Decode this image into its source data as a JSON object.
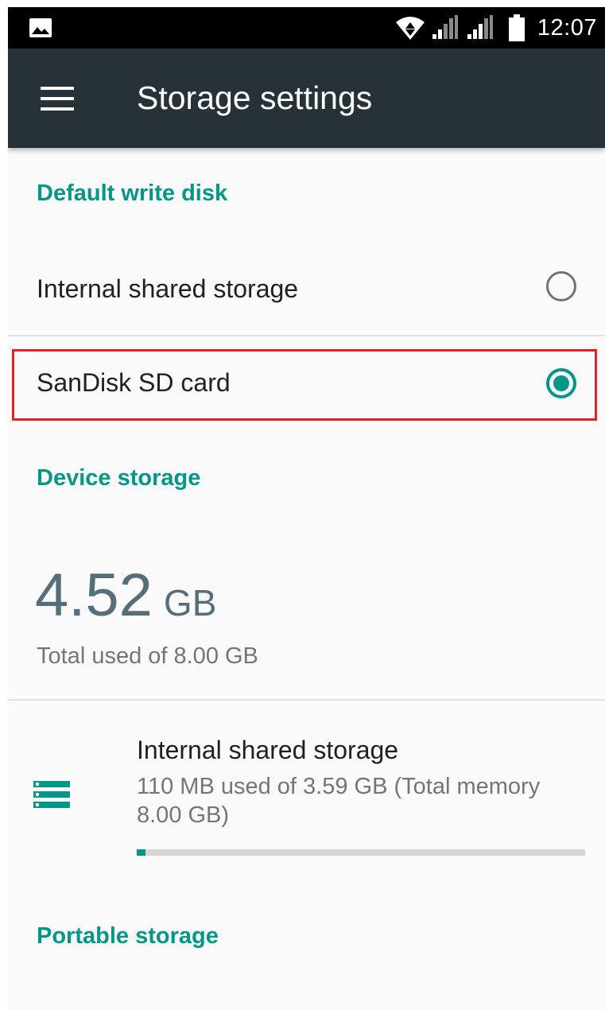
{
  "status_bar": {
    "time": "12:07",
    "icons": [
      "image-notification-icon",
      "wifi-icon",
      "signal-icon",
      "signal-icon",
      "battery-icon"
    ]
  },
  "app_bar": {
    "title": "Storage settings",
    "menu_icon": "hamburger-menu-icon"
  },
  "default_write_disk": {
    "header": "Default write disk",
    "options": [
      {
        "label": "Internal shared storage",
        "selected": false
      },
      {
        "label": "SanDisk SD card",
        "selected": true
      }
    ]
  },
  "device_storage": {
    "header": "Device storage",
    "used_value": "4.52",
    "used_unit": "GB",
    "total_text": "Total used of 8.00 GB",
    "volume": {
      "icon": "storage-icon",
      "title": "Internal shared storage",
      "summary": "110 MB used of 3.59 GB (Total memory 8.00 GB)",
      "used_fraction": 0.02
    }
  },
  "portable_storage": {
    "header": "Portable storage"
  },
  "colors": {
    "accent": "#009688",
    "app_bar": "#263238",
    "highlight": "#e5202b"
  }
}
